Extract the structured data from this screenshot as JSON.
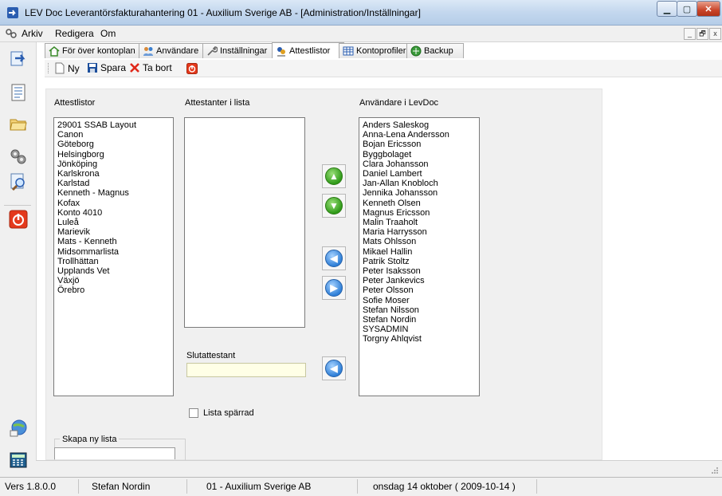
{
  "window": {
    "title": "LEV Doc  Leverantörsfakturahantering  01 - Auxilium Sverige AB - [Administration/Inställningar]"
  },
  "menu": {
    "items": [
      "Arkiv",
      "Redigera",
      "Om"
    ]
  },
  "tabs": [
    {
      "label": "För över kontoplan",
      "icon": "home-icon"
    },
    {
      "label": "Användare",
      "icon": "users-icon"
    },
    {
      "label": "Inställningar",
      "icon": "wrench-icon"
    },
    {
      "label": "Attestlistor",
      "icon": "attest-icon",
      "active": true
    },
    {
      "label": "Kontoprofiler",
      "icon": "grid-icon"
    },
    {
      "label": "Backup",
      "icon": "backup-icon"
    }
  ],
  "toolbar": {
    "new_label": "Ny",
    "save_label": "Spara",
    "delete_label": "Ta bort"
  },
  "panel": {
    "attestlistor_label": "Attestlistor",
    "attestanter_label": "Attestanter i lista",
    "anvandare_label": "Användare i LevDoc",
    "slutattestant_label": "Slutattestant",
    "slutattestant_value": "",
    "lista_sparrad_label": "Lista spärrad",
    "lista_sparrad_checked": false,
    "skapa_ny_lista_label": "Skapa ny lista",
    "attestlistor": [
      "29001 SSAB Layout",
      "Canon",
      "Göteborg",
      "Helsingborg",
      "Jönköping",
      "Karlskrona",
      "Karlstad",
      "Kenneth - Magnus",
      "Kofax",
      "Konto 4010",
      "Luleå",
      "Marievik",
      "Mats - Kenneth",
      "Midsommarlista",
      "Trollhättan",
      "Upplands Vet",
      "Växjö",
      "Örebro"
    ],
    "attestanter": [],
    "anvandare": [
      "Anders Saleskog",
      "Anna-Lena Andersson",
      "Bojan Ericsson",
      "Byggbolaget",
      "Clara Johansson",
      "Daniel Lambert",
      "Jan-Allan Knobloch",
      "Jennika Johansson",
      "Kenneth Olsen",
      "Magnus Ericsson",
      "Malin Traaholt",
      "Maria Harrysson",
      "Mats Ohlsson",
      "Mikael Hallin",
      "Patrik Stoltz",
      "Peter Isaksson",
      "Peter Jankevics",
      "Peter Olsson",
      "Sofie Moser",
      "Stefan Nilsson",
      "Stefan Nordin",
      "SYSADMIN",
      "Torgny Ahlqvist"
    ]
  },
  "status": {
    "version": "Vers 1.8.0.0",
    "user": "Stefan Nordin",
    "company": "01 - Auxilium Sverige AB",
    "date": "onsdag 14 oktober ( 2009-10-14 )"
  },
  "colors": {
    "accent": "#2f7fd7",
    "green": "#2f9a18",
    "stop": "#d9361f"
  }
}
